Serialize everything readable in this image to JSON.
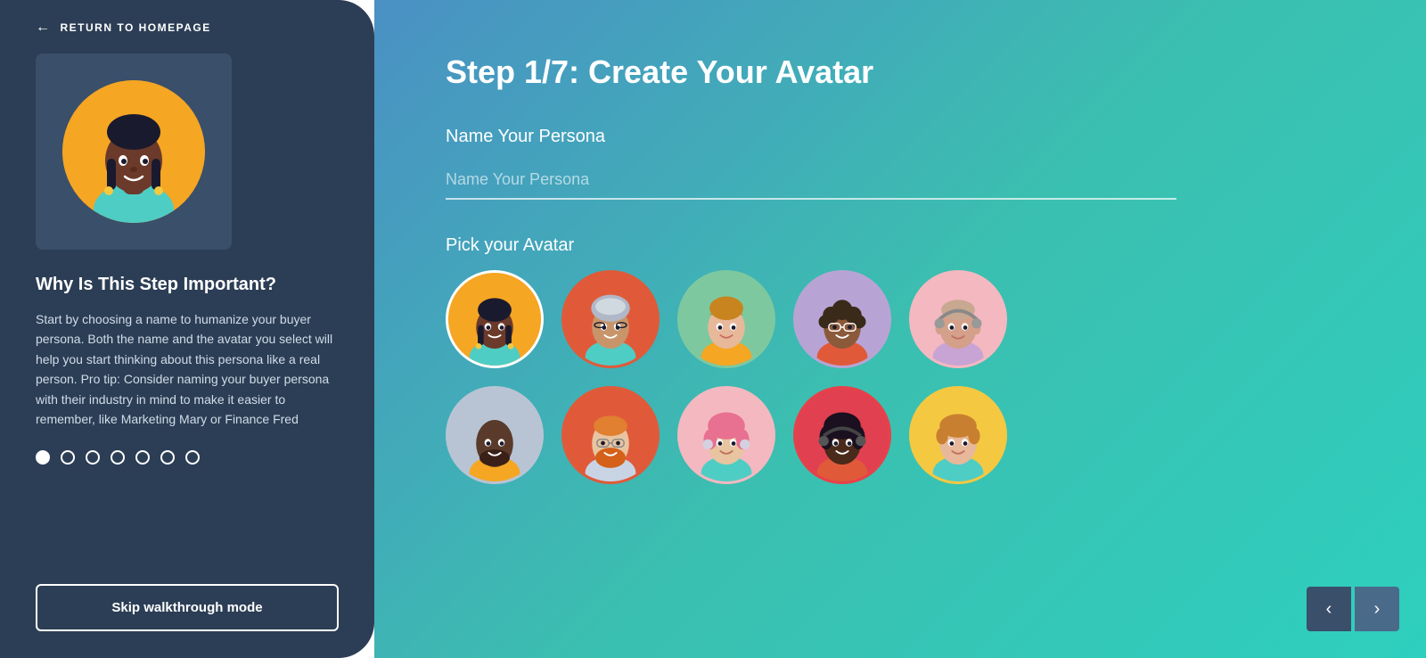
{
  "sidebar": {
    "return_label": "RETURN TO HOMEPAGE",
    "why_title": "Why Is This Step Important?",
    "why_text": "Start by choosing a name to humanize your buyer persona. Both the name and the avatar you select will help you start thinking about this persona like a real person. Pro tip: Consider naming your buyer persona with their industry in mind to make it easier to remember, like Marketing Mary or Finance Fred",
    "skip_label": "Skip walkthrough mode",
    "dots": [
      {
        "active": true
      },
      {
        "active": false
      },
      {
        "active": false
      },
      {
        "active": false
      },
      {
        "active": false
      },
      {
        "active": false
      },
      {
        "active": false
      }
    ]
  },
  "main": {
    "step_title": "Step 1/7: Create Your Avatar",
    "persona_section_label": "Name Your Persona",
    "persona_placeholder": "Name Your Persona",
    "avatar_section_label": "Pick your Avatar",
    "avatars": [
      {
        "id": 1,
        "color": "#f5a623",
        "selected": true
      },
      {
        "id": 2,
        "color": "#e05a3a",
        "selected": false
      },
      {
        "id": 3,
        "color": "#7ec8a0",
        "selected": false
      },
      {
        "id": 4,
        "color": "#b8a4d4",
        "selected": false
      },
      {
        "id": 5,
        "color": "#f4b8c0",
        "selected": false
      },
      {
        "id": 6,
        "color": "#b8c4d4",
        "selected": false
      },
      {
        "id": 7,
        "color": "#e05a3a",
        "selected": false
      },
      {
        "id": 8,
        "color": "#f4b8c0",
        "selected": false
      },
      {
        "id": 9,
        "color": "#e05050",
        "selected": false
      },
      {
        "id": 10,
        "color": "#f5c842",
        "selected": false
      }
    ]
  },
  "nav": {
    "prev_label": "‹",
    "next_label": "›"
  }
}
